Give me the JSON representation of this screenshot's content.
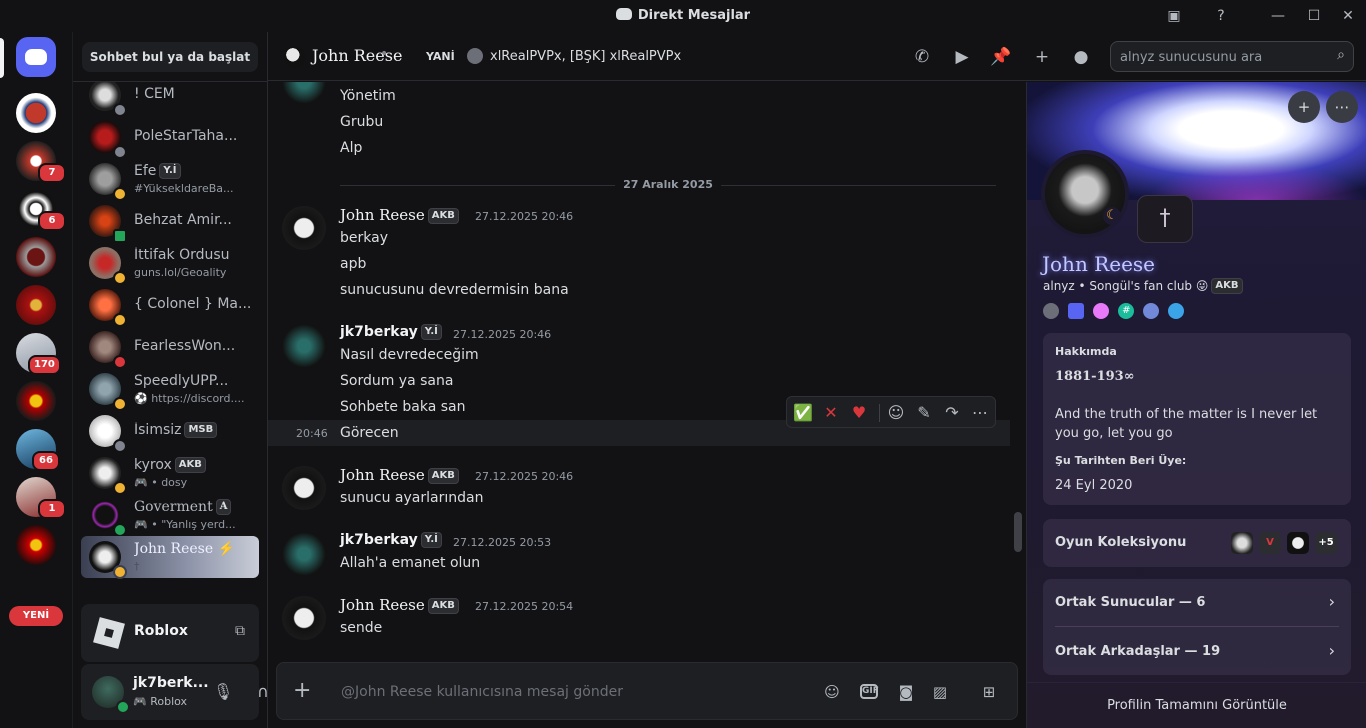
{
  "window": {
    "title": "Direkt Mesajlar"
  },
  "servers": {
    "items": [
      {
        "badge": ""
      },
      {
        "badge": ""
      },
      {
        "badge": "7"
      },
      {
        "badge": "6"
      },
      {
        "badge": ""
      },
      {
        "badge": ""
      },
      {
        "badge": "170"
      },
      {
        "badge": ""
      },
      {
        "badge": "66"
      },
      {
        "badge": "1"
      },
      {
        "badge": ""
      }
    ],
    "new_label": "YENİ"
  },
  "dm_sidebar": {
    "search_label": "Sohbet bul ya da başlat",
    "items": [
      {
        "name": "! CEM",
        "sub": "",
        "tag": ""
      },
      {
        "name": "PoleStarTaha...",
        "sub": "",
        "tag": ""
      },
      {
        "name": "Efe",
        "sub": "#YüksekldareBa...",
        "tag": "Y.İ"
      },
      {
        "name": "Behzat Amir...",
        "sub": "",
        "tag": ""
      },
      {
        "name": "İttifak Ordusu",
        "sub": "guns.lol/Geoality",
        "tag": ""
      },
      {
        "name": "{ Colonel } Ma...",
        "sub": "",
        "tag": ""
      },
      {
        "name": "FearlessWon...",
        "sub": "",
        "tag": ""
      },
      {
        "name": "SpeedlyUPP...",
        "sub": "https://discord....",
        "tag": ""
      },
      {
        "name": "İsimsiz",
        "sub": "",
        "tag": "MSB"
      },
      {
        "name": "kyrox",
        "sub": "• dosy",
        "tag": "AKB"
      },
      {
        "name": "Goverment",
        "sub": "• \"Yanlış yerd...",
        "tag": "A"
      },
      {
        "name": "John Reese",
        "sub": "†",
        "tag": ""
      }
    ],
    "activity": {
      "name": "Roblox"
    },
    "user": {
      "name": "jk7berk...",
      "status": "Roblox"
    }
  },
  "header": {
    "name": "John Reese",
    "dot": "•",
    "new_label": "YANİ",
    "guild": "xlRealPVPx, [BŞK] xlRealPVPx",
    "search_placeholder": "alnyz sunucusunu ara"
  },
  "chat": {
    "date_divider": "27 Aralık 2025",
    "top_lines": [
      "Yönetim",
      "Grubu",
      "Alp"
    ],
    "messages": [
      {
        "author": "John Reese",
        "tag": "AKB",
        "time": "27.12.2025 20:46",
        "lines": [
          "berkay",
          "apb",
          "sunucusunu devredermisin bana"
        ]
      },
      {
        "author": "jk7berkay",
        "tag": "Y.İ",
        "time": "27.12.2025 20:46",
        "lines": [
          "Nasıl devredeceğim",
          "Sordum ya sana",
          "Sohbete baka san"
        ]
      },
      {
        "author": "John Reese",
        "tag": "AKB",
        "time": "27.12.2025 20:46",
        "lines": [
          "sunucu ayarlarından"
        ]
      },
      {
        "author": "jk7berkay",
        "tag": "Y.İ",
        "time": "27.12.2025 20:53",
        "lines": [
          "Allah'a emanet olun"
        ]
      },
      {
        "author": "John Reese",
        "tag": "AKB",
        "time": "27.12.2025 20:54",
        "lines": [
          "sende"
        ]
      }
    ],
    "hover_time": "20:46",
    "hover_line": "Görecen",
    "composer_placeholder": "@John Reese kullanıcısına mesaj gönder"
  },
  "profile": {
    "name": "John Reese",
    "sub": "alnyz • Songül's fan club 😜",
    "tag": "AKB",
    "about_label": "Hakkımda",
    "about_title": "1881-193∞",
    "about_text": "And the truth of the matter is I never let you go, let you go",
    "member_since_label": "Şu Tarihten Beri Üye:",
    "member_since": "24 Eyl 2020",
    "games_label": "Oyun Koleksiyonu",
    "games_more": "+5",
    "mutual_servers": "Ortak Sunucular — 6",
    "mutual_friends": "Ortak Arkadaşlar — 19",
    "footer": "Profilin Tamamını Görüntüle"
  }
}
